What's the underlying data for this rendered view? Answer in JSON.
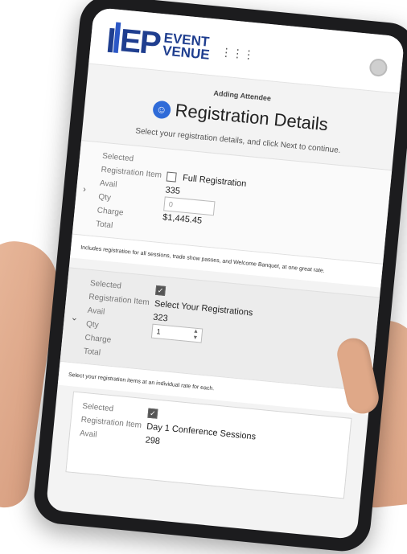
{
  "header": {
    "logo_letters": "EP",
    "logo_word1": "EVENT",
    "logo_word2": "VENUE",
    "grid_icon": "grid-icon",
    "avatar_icon": "user-avatar-icon"
  },
  "page": {
    "breadcrumb": "Adding Attendee",
    "title": "Registration Details",
    "subtitle": "Select your registration details, and click Next to continue."
  },
  "labels": {
    "selected": "Selected",
    "registration_item": "Registration Item",
    "avail": "Avail",
    "qty": "Qty",
    "charge": "Charge",
    "total": "Total"
  },
  "items": [
    {
      "selected": false,
      "name": "Full Registration",
      "avail": "335",
      "qty_placeholder": "0",
      "charge": "$1,445.45",
      "note": "Includes registration for all sessions, trade show passes, and Welcome Banquet, at one great rate."
    },
    {
      "selected": true,
      "name": "Select Your Registrations",
      "avail": "323",
      "qty": "1",
      "note": "Select your registration items at an individual rate for each."
    }
  ],
  "subitem": {
    "selected": true,
    "name": "Day 1 Conference Sessions",
    "avail": "298"
  },
  "colors": {
    "brand_dark": "#1f3e8f",
    "brand_accent": "#2f6bd8",
    "device_frame": "#1c1c1e"
  }
}
